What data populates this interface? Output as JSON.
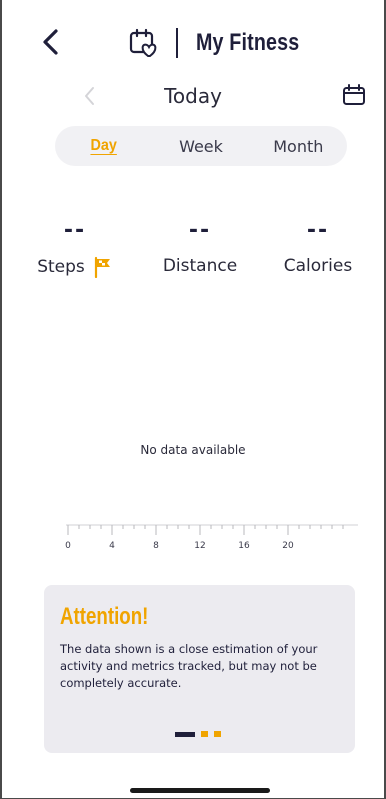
{
  "header": {
    "title": "My Fitness",
    "back_icon": "chevron-left-icon",
    "app_icon": "calendar-heart-icon"
  },
  "date_nav": {
    "label": "Today",
    "prev_icon": "chevron-left-icon",
    "calendar_icon": "calendar-icon"
  },
  "tabs": [
    {
      "label": "Day",
      "active": true
    },
    {
      "label": "Week",
      "active": false
    },
    {
      "label": "Month",
      "active": false
    }
  ],
  "metrics": [
    {
      "value": "--",
      "label": "Steps",
      "icon": "goal-flag-icon"
    },
    {
      "value": "--",
      "label": "Distance"
    },
    {
      "value": "--",
      "label": "Calories"
    }
  ],
  "chart": {
    "empty_message": "No data available",
    "axis_ticks": [
      "0",
      "4",
      "8",
      "12",
      "16",
      "20"
    ]
  },
  "attention": {
    "title": "Attention!",
    "body": "The data shown is a close estimation of your activity and metrics tracked, but may not be completely accurate.",
    "pager": {
      "pages": 3,
      "current": 0
    }
  },
  "colors": {
    "accent": "#f0a400",
    "primary": "#1f1f3a",
    "card_bg": "#ecebf0",
    "tab_bg": "#f1f1f4"
  }
}
